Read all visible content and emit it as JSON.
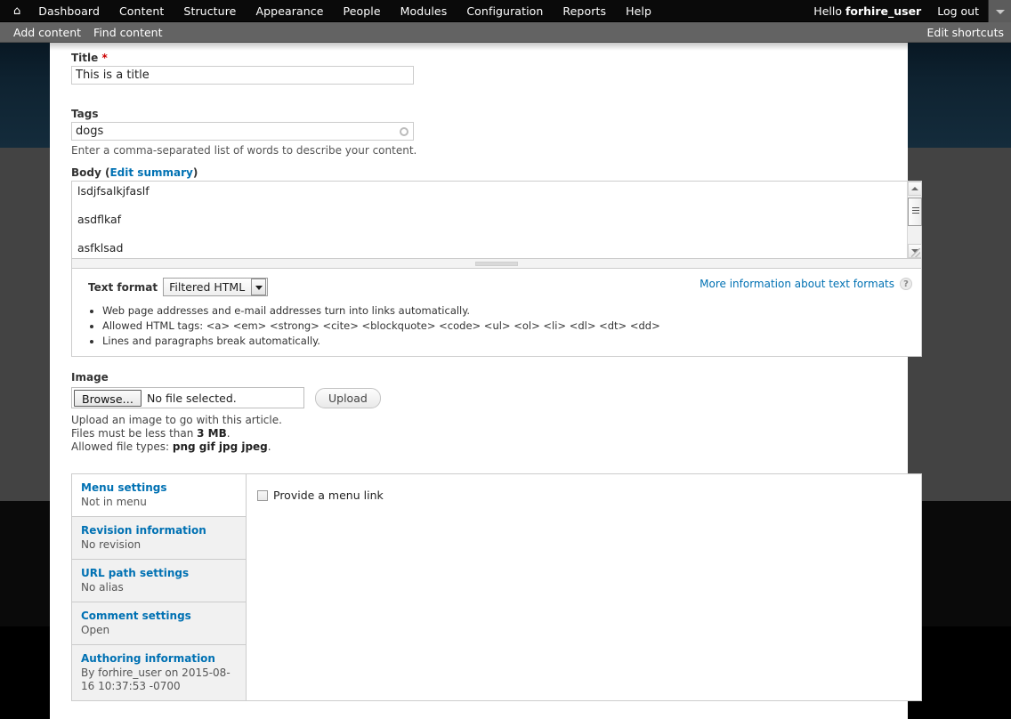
{
  "toolbar": {
    "home_icon": "home-icon",
    "menu": [
      {
        "label": "Dashboard"
      },
      {
        "label": "Content"
      },
      {
        "label": "Structure"
      },
      {
        "label": "Appearance"
      },
      {
        "label": "People"
      },
      {
        "label": "Modules"
      },
      {
        "label": "Configuration"
      },
      {
        "label": "Reports"
      },
      {
        "label": "Help"
      }
    ],
    "greeting_prefix": "Hello",
    "username": "forhire_user",
    "logout_label": "Log out",
    "toggle_icon": "chevron-down-icon"
  },
  "shortcuts": {
    "items": [
      {
        "label": "Add content"
      },
      {
        "label": "Find content"
      }
    ],
    "edit_label": "Edit shortcuts"
  },
  "form": {
    "title": {
      "label": "Title",
      "required_marker": "*",
      "value": "This is a title"
    },
    "tags": {
      "label": "Tags",
      "value": "dogs",
      "description": "Enter a comma-separated list of words to describe your content.",
      "throbber_icon": "autocomplete-throbber-icon"
    },
    "body": {
      "label": "Body",
      "edit_summary_label": "Edit summary",
      "value": "lsdjfsalkjfaslf\n\nasdflkaf\n\nasfklsad\n\nfasdlkfj\n\nadflkkadf\n\nlkasdlf",
      "scrollbar": {
        "up_icon": "scroll-up-arrow-icon",
        "down_icon": "scroll-down-arrow-icon",
        "resize_icon": "resize-corner-icon"
      },
      "grippie_icon": "drag-grippie-icon"
    },
    "text_format": {
      "label": "Text format",
      "selected": "Filtered HTML",
      "options": [
        "Filtered HTML"
      ],
      "dropdown_icon": "chevron-down-icon",
      "tips": [
        "Web page addresses and e-mail addresses turn into links automatically.",
        "Allowed HTML tags: <a> <em> <strong> <cite> <blockquote> <code> <ul> <ol> <li> <dl> <dt> <dd>",
        "Lines and paragraphs break automatically."
      ],
      "more_info_label": "More information about text formats",
      "help_icon": "question-mark-icon",
      "help_glyph": "?"
    },
    "image": {
      "label": "Image",
      "browse_label": "Browse…",
      "no_file_text": "No file selected.",
      "upload_label": "Upload",
      "desc_line1": "Upload an image to go with this article.",
      "desc_line2_pre": "Files must be less than ",
      "desc_line2_bold": "3 MB",
      "desc_line2_post": ".",
      "desc_line3_pre": "Allowed file types: ",
      "desc_line3_bold": "png gif jpg jpeg",
      "desc_line3_post": "."
    },
    "vertical_tabs": [
      {
        "title": "Menu settings",
        "summary": "Not in menu",
        "selected": true
      },
      {
        "title": "Revision information",
        "summary": "No revision",
        "selected": false
      },
      {
        "title": "URL path settings",
        "summary": "No alias",
        "selected": false
      },
      {
        "title": "Comment settings",
        "summary": "Open",
        "selected": false
      },
      {
        "title": "Authoring information",
        "summary": "By forhire_user on 2015-08-16 10:37:53 -0700",
        "selected": false
      }
    ],
    "menu_pane": {
      "checkbox_label": "Provide a menu link",
      "checked": false
    }
  },
  "colors": {
    "link": "#0071b3",
    "required": "#cc0000",
    "toolbar_bg": "#0a0a0a",
    "shortcut_bg": "#636363",
    "page_navy": "#122a3a",
    "page_gray": "#434343"
  }
}
